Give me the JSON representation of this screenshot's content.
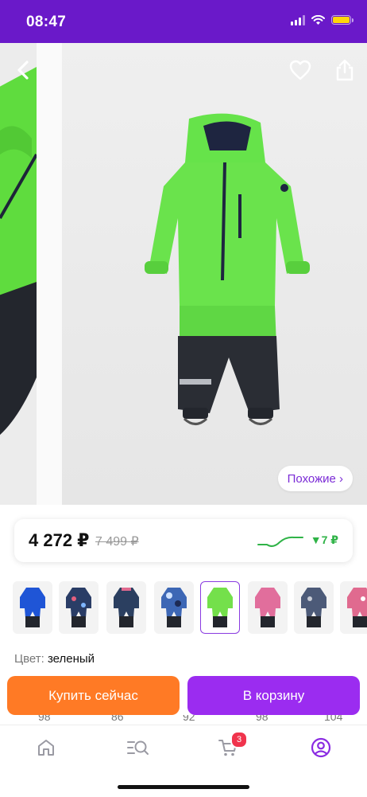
{
  "status_bar": {
    "time": "08:47"
  },
  "gallery": {
    "similar_label": "Похожие ›"
  },
  "price": {
    "current": "4 272 ₽",
    "old": "7 499 ₽",
    "drop": "▼7 ₽",
    "colors": {
      "drop": "#2fb347"
    }
  },
  "thumbnails": [
    {
      "color": "#1f55d6",
      "selected": false
    },
    {
      "color": "#2a3d66",
      "selected": false
    },
    {
      "color": "#2b3f60",
      "selected": false
    },
    {
      "color": "#3d67b5",
      "selected": false
    },
    {
      "color": "#74e04b",
      "selected": true
    },
    {
      "color": "#e16e9c",
      "selected": false
    },
    {
      "color": "#4c5a78",
      "selected": false
    },
    {
      "color": "#e06a8f",
      "selected": false
    }
  ],
  "color_info": {
    "label": "Цвет:",
    "value": "зеленый"
  },
  "actions": {
    "buy_now": "Купить сейчас",
    "add_to_cart": "В корзину"
  },
  "peek_values": [
    "98",
    "86",
    "92",
    "98",
    "104"
  ],
  "tabbar": {
    "cart_badge": "3"
  },
  "colors": {
    "brand": "#6a19c9",
    "buy": "#ff7a25",
    "cart": "#9b2cf0",
    "accent": "#7b2bd6"
  }
}
